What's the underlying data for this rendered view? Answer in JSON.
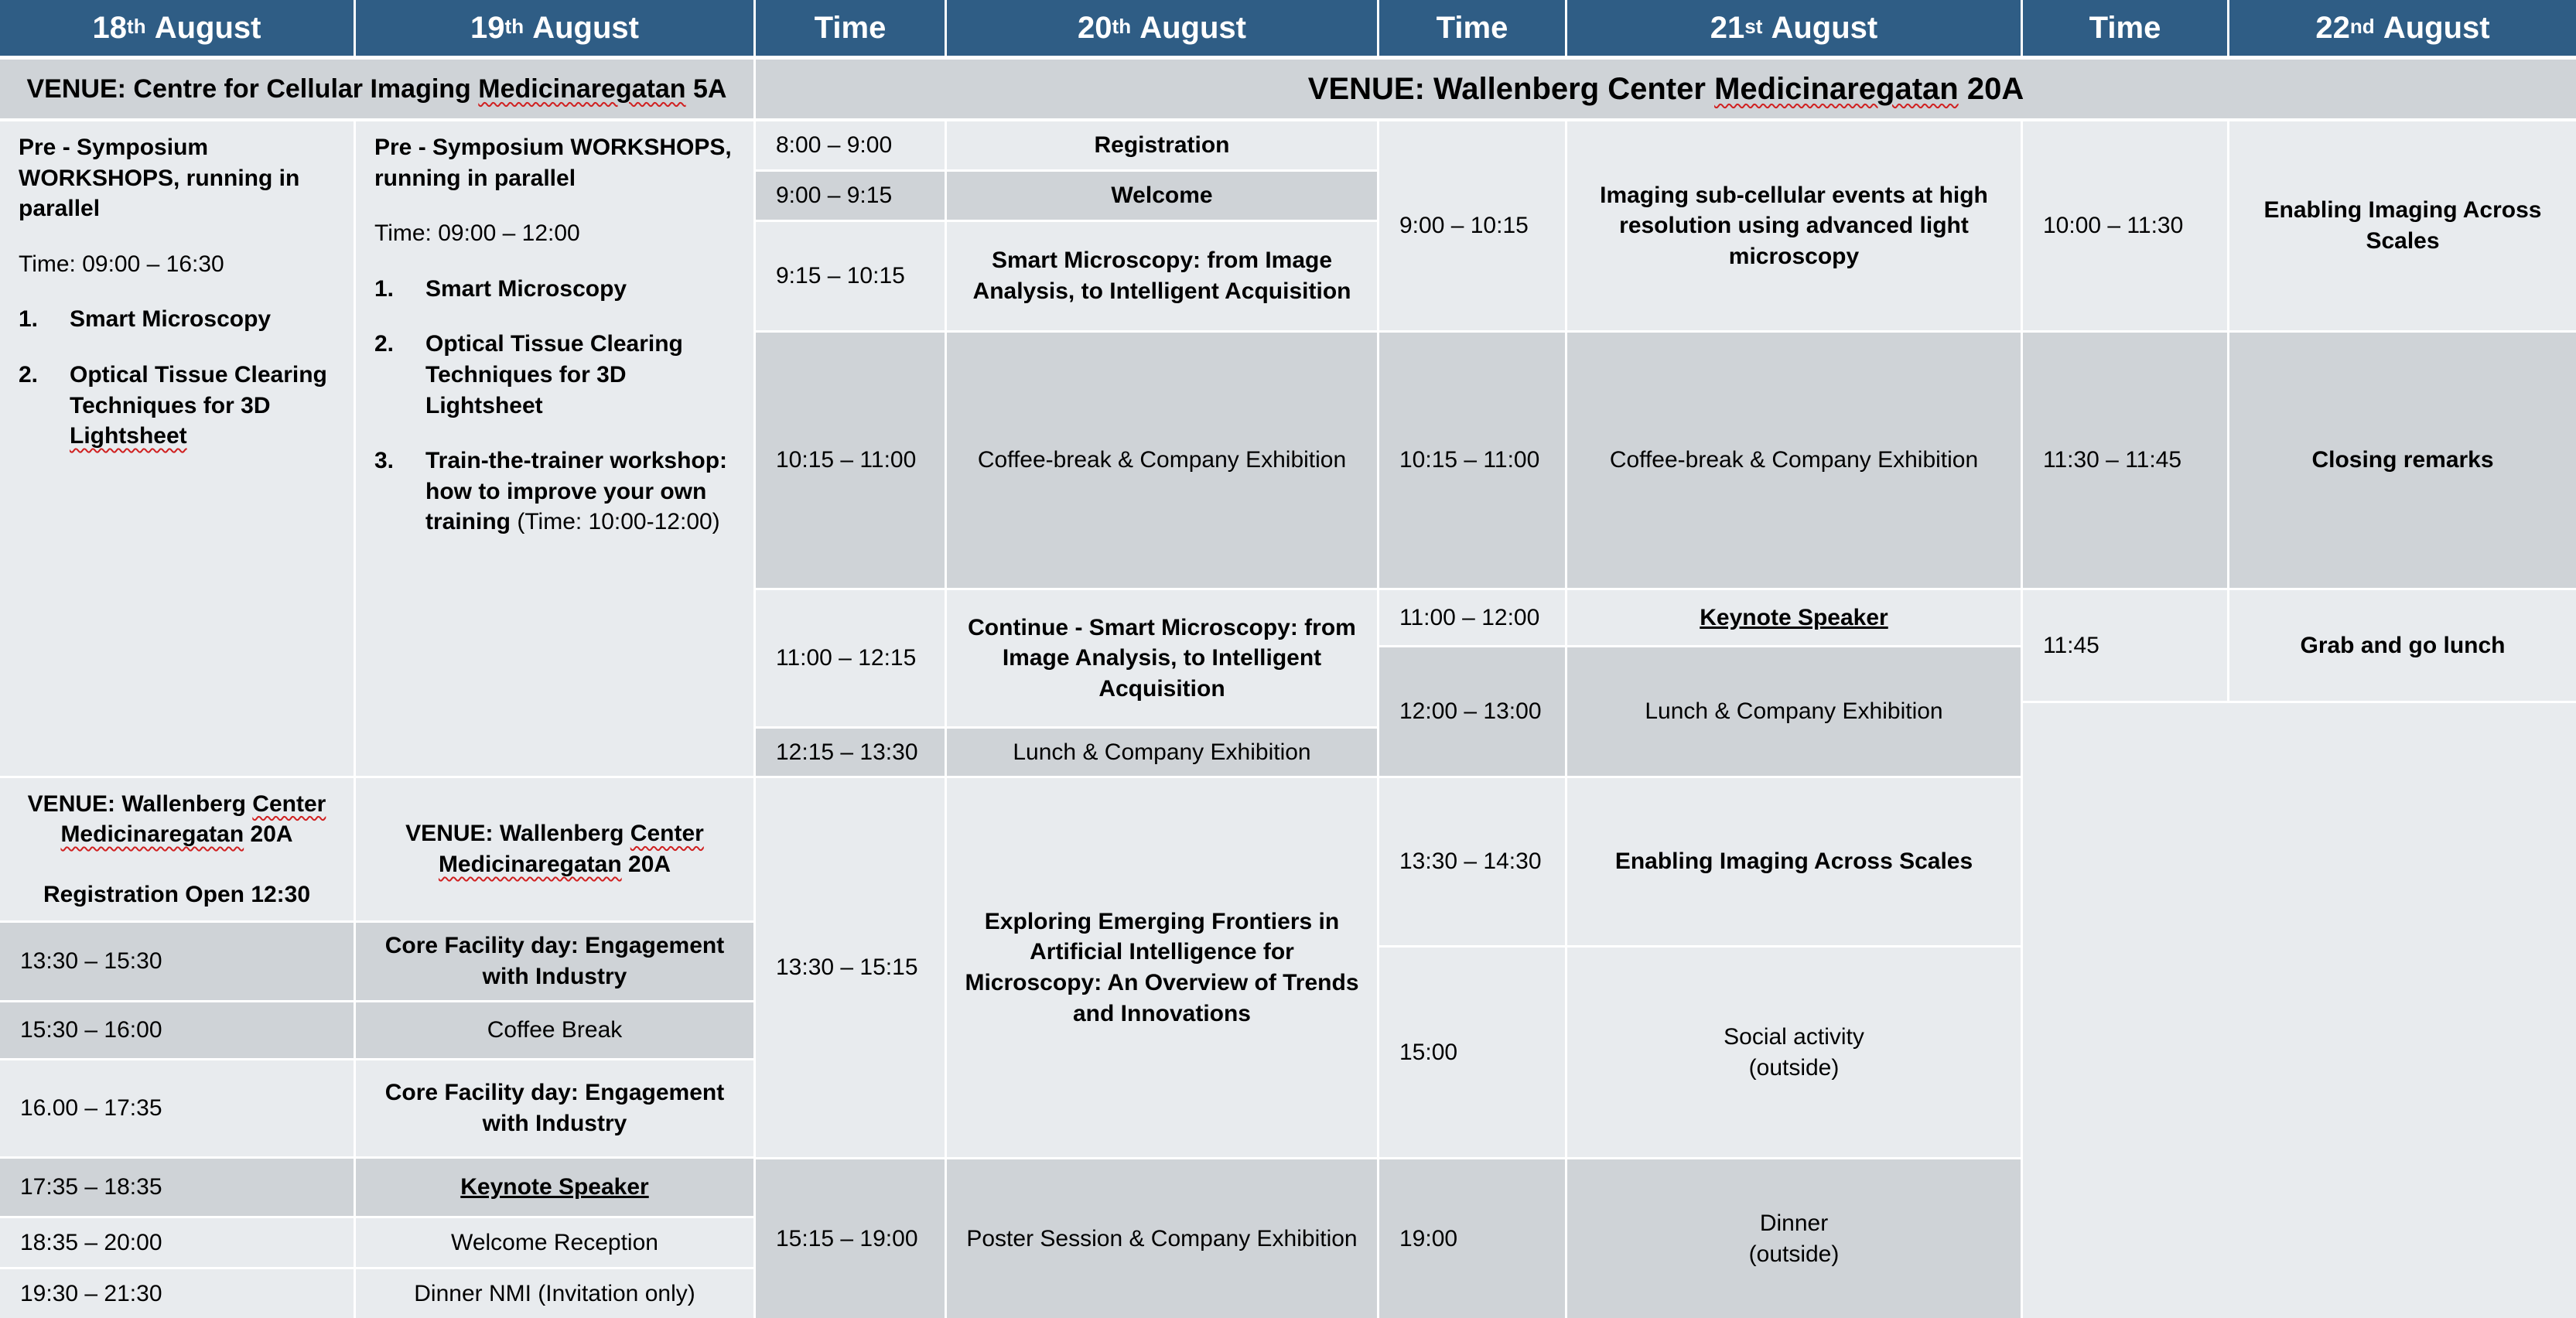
{
  "header": {
    "d18": {
      "day": "18",
      "suffix": "th",
      "month": "August"
    },
    "d19": {
      "day": "19",
      "suffix": "th",
      "month": "August"
    },
    "time_a": "Time",
    "d20": {
      "day": "20",
      "suffix": "th",
      "month": "August"
    },
    "time_b": "Time",
    "d21": {
      "day": "21",
      "suffix": "st",
      "month": "August"
    },
    "time_c": "Time",
    "d22": {
      "day": "22",
      "suffix": "nd",
      "month": "August"
    }
  },
  "venues": {
    "cci": {
      "pre": "VENUE: Centre for Cellular Imaging ",
      "street": "Medicinaregatan",
      "post": " 5A"
    },
    "wallenberg_main": {
      "pre": "VENUE: Wallenberg Center ",
      "street": "Medicinaregatan",
      "post": " 20A"
    }
  },
  "day18": {
    "workshop_title": "Pre - Symposium WORKSHOPS, running in parallel",
    "time": "Time: 09:00 – 16:30",
    "items": [
      {
        "num": "1.",
        "text": "Smart Microscopy"
      },
      {
        "num": "2.",
        "text_a": "Optical Tissue Clearing Techniques for  3D ",
        "text_b": "Lightsheet"
      }
    ],
    "venue": {
      "pre": "VENUE: Wallenberg ",
      "center": "Center",
      "street": "Medicinaregatan",
      "post": " 20A"
    },
    "registration": "Registration Open 12:30",
    "times": [
      "13:30 – 15:30",
      "15:30 – 16:00",
      "16.00 – 17:35",
      "17:35 – 18:35",
      "18:35 – 20:00",
      "19:30 – 21:30"
    ]
  },
  "day19": {
    "workshop_title": "Pre - Symposium WORKSHOPS, running in parallel",
    "time": "Time: 09:00 – 12:00",
    "items": [
      {
        "num": "1.",
        "text": "Smart Microscopy"
      },
      {
        "num": "2.",
        "text": "Optical Tissue Clearing Techniques for  3D Lightsheet"
      },
      {
        "num": "3.",
        "text_bold": "Train-the-trainer workshop: how to improve your own training",
        "text_normal": " (Time: 10:00-12:00)"
      }
    ],
    "venue": {
      "pre": "VENUE: Wallenberg ",
      "center": "Center",
      "street": "Medicinaregatan",
      "post": " 20A"
    },
    "sessions": [
      "Core Facility day: Engagement with Industry",
      "Coffee Break",
      "Core Facility day: Engagement with Industry",
      "Keynote Speaker",
      "Welcome  Reception",
      "Dinner NMI (Invitation only)"
    ]
  },
  "day20": {
    "times": [
      "8:00 – 9:00",
      "9:00 – 9:15",
      "9:15 – 10:15",
      "10:15 – 11:00",
      "11:00 – 12:15",
      "12:15 – 13:30",
      "13:30 – 15:15",
      "15:15 – 19:00"
    ],
    "sessions": [
      "Registration",
      "Welcome",
      "Smart Microscopy: from Image Analysis, to Intelligent Acquisition",
      "Coffee-break & Company Exhibition",
      "Continue - Smart Microscopy: from Image Analysis, to Intelligent Acquisition",
      "Lunch  & Company Exhibition",
      "Exploring Emerging Frontiers in Artificial Intelligence for Microscopy: An Overview of Trends and Innovations",
      "Poster Session & Company Exhibition"
    ]
  },
  "day21": {
    "times": [
      "9:00 – 10:15",
      "10:15 – 11:00",
      "11:00 – 12:00",
      "12:00 – 13:00",
      "13:30 – 14:30",
      "15:00",
      "19:00"
    ],
    "sessions": [
      "Imaging sub-cellular events at high resolution using advanced light microscopy",
      "Coffee-break & Company Exhibition",
      "Keynote Speaker",
      "Lunch & Company Exhibition",
      "Enabling Imaging Across Scales"
    ],
    "social": {
      "line1": "Social activity",
      "line2": "(outside)"
    },
    "dinner": {
      "line1": "Dinner",
      "line2": "(outside)"
    }
  },
  "day22": {
    "times": [
      "10:00 – 11:30",
      "11:30 – 11:45",
      "11:45"
    ],
    "sessions": [
      "Enabling Imaging Across Scales",
      "Closing remarks",
      "Grab and go lunch"
    ]
  }
}
